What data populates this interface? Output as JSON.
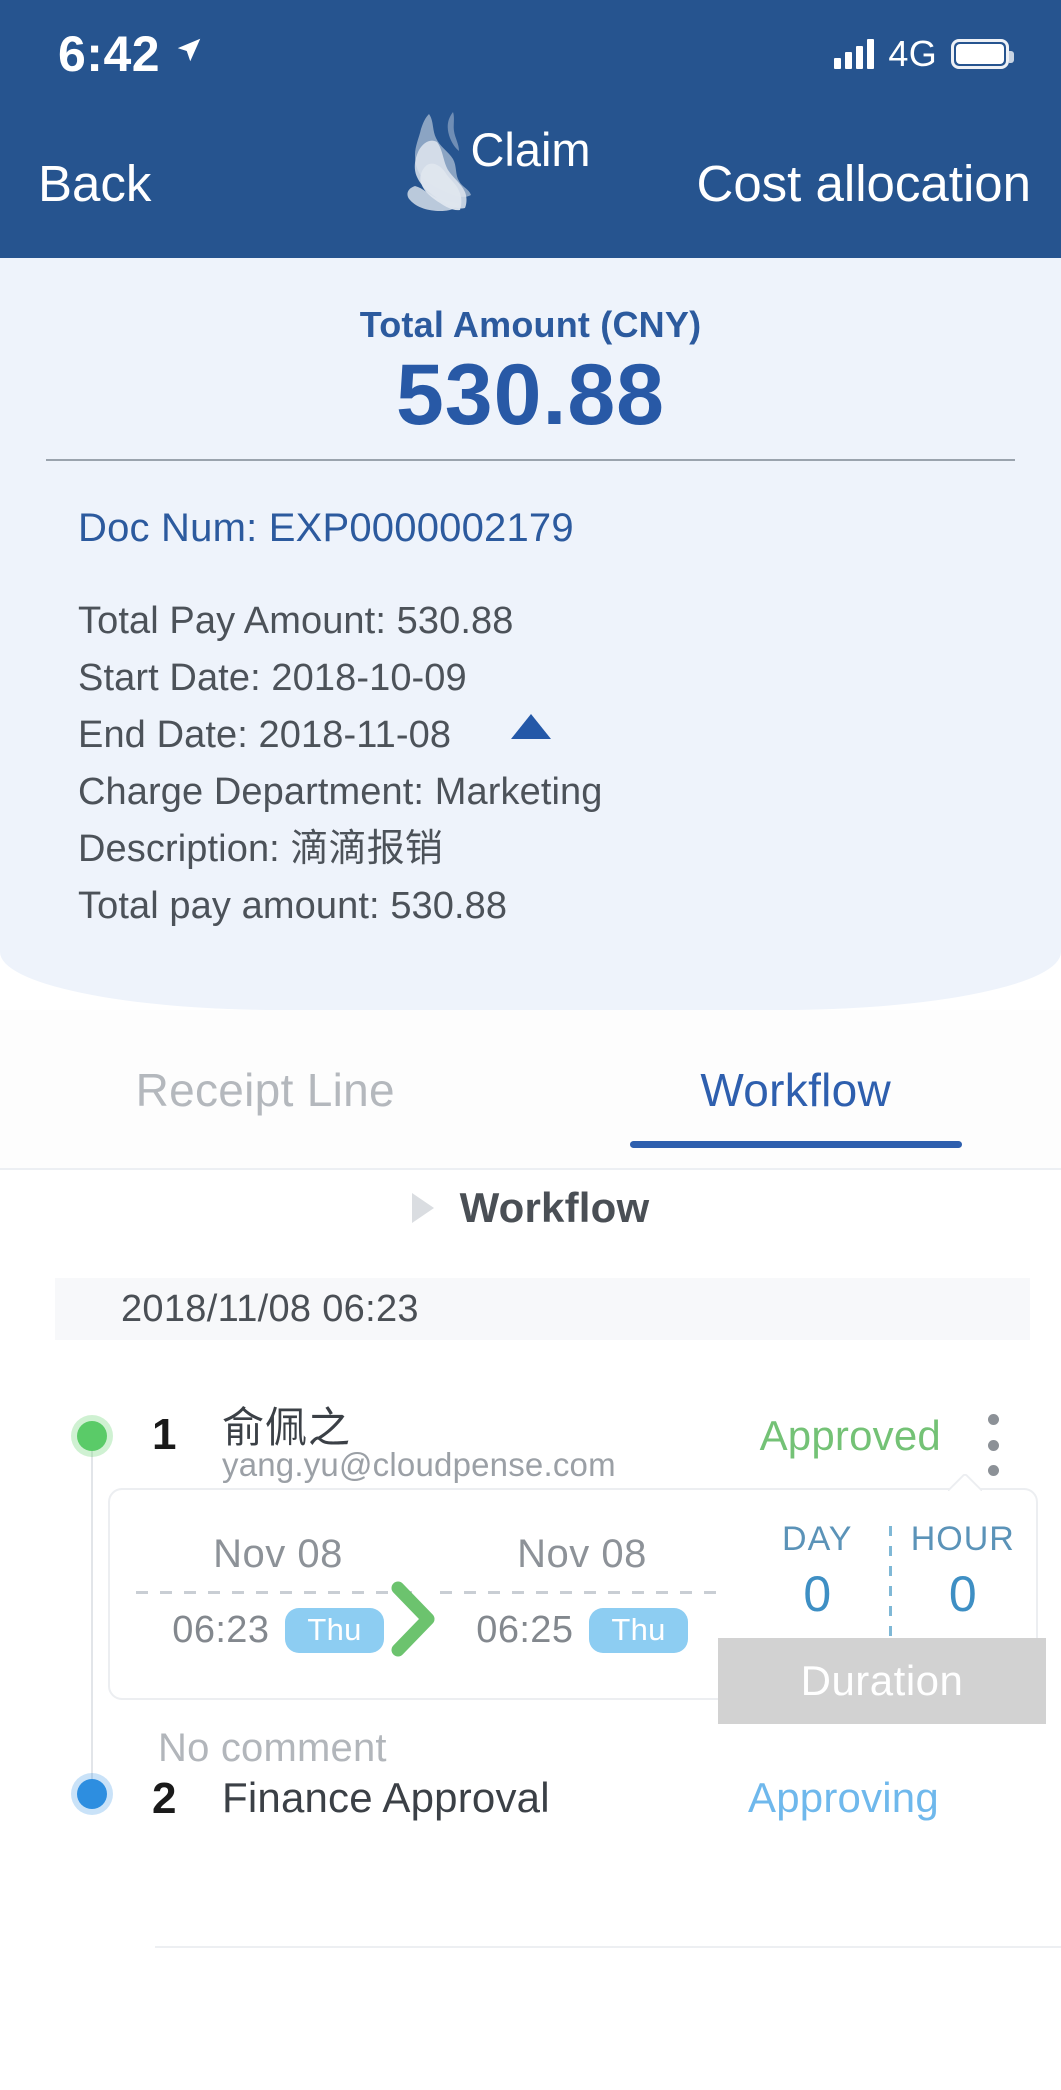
{
  "status_bar": {
    "time": "6:42",
    "location_icon": "location-arrow-icon",
    "signal_icon": "signal-bars-icon",
    "network": "4G",
    "battery_icon": "battery-full-icon"
  },
  "nav": {
    "back_label": "Back",
    "title": "Claim",
    "right_action_label": "Cost allocation"
  },
  "summary": {
    "amount_label": "Total Amount (CNY)",
    "amount_value": "530.88",
    "doc_num": "Doc Num: EXP0000002179",
    "details": [
      "Total Pay Amount: 530.88",
      "Start Date: 2018-10-09",
      "End Date: 2018-11-08",
      "Charge Department: Marketing",
      "Description: 滴滴报销",
      "Total pay amount: 530.88"
    ],
    "collapse_icon": "triangle-up-icon"
  },
  "tabs": [
    {
      "label": "Receipt Line",
      "active": false
    },
    {
      "label": "Workflow",
      "active": true
    }
  ],
  "workflow": {
    "section_icon": "triangle-right-icon",
    "section_label": "Workflow",
    "date_header": "2018/11/08 06:23",
    "steps": [
      {
        "index": "1",
        "name": "俞佩之",
        "email": "yang.yu@cloudpense.com",
        "status": "Approved",
        "status_color": "#74C276",
        "node_color": "#5ACB68",
        "menu_icon": "kebab-menu-icon",
        "comment": "No comment"
      },
      {
        "index": "2",
        "name": "Finance Approval",
        "status": "Approving",
        "status_color": "#6FB8EC",
        "node_color": "#2D8EE0"
      }
    ],
    "duration_card": {
      "start": {
        "date": "Nov 08",
        "time": "06:23",
        "dow": "Thu"
      },
      "end": {
        "date": "Nov 08",
        "time": "06:25",
        "dow": "Thu"
      },
      "arrow_icon": "chevron-right-icon",
      "metrics": [
        {
          "label": "DAY",
          "value": "0"
        },
        {
          "label": "HOUR",
          "value": "0"
        }
      ]
    },
    "tooltip_label": "Duration"
  },
  "colors": {
    "header_blue": "#26548F",
    "accent_blue": "#2C5A9E",
    "panel_bg": "#eef3fb",
    "tab_active": "#2E5FAE",
    "approved_green": "#74C276",
    "approving_blue": "#6FB8EC",
    "tooltip_gray": "#D2D2D2",
    "badge_blue": "#8DCDF2"
  }
}
